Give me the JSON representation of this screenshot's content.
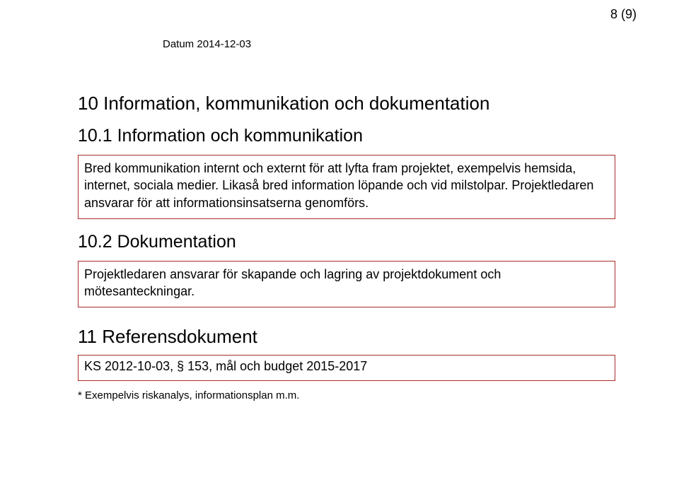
{
  "page_number": "8 (9)",
  "date_label": "Datum 2014-12-03",
  "section10": {
    "title": "10 Information, kommunikation och dokumentation",
    "sub1_title": "10.1  Information och kommunikation",
    "sub1_box": "Bred kommunikation internt och externt för att lyfta fram projektet, exempelvis hemsida, internet, sociala medier. Likaså bred information löpande och vid milstolpar. Projektledaren ansvarar för att informationsinsatserna genomförs.",
    "sub2_title": "10.2  Dokumentation",
    "sub2_box": "Projektledaren ansvarar för skapande och lagring av projektdokument och mötesanteckningar."
  },
  "section11": {
    "title": "11 Referensdokument",
    "box": "KS 2012-10-03, § 153, mål och budget 2015-2017"
  },
  "footnote": "* Exempelvis riskanalys, informationsplan m.m."
}
